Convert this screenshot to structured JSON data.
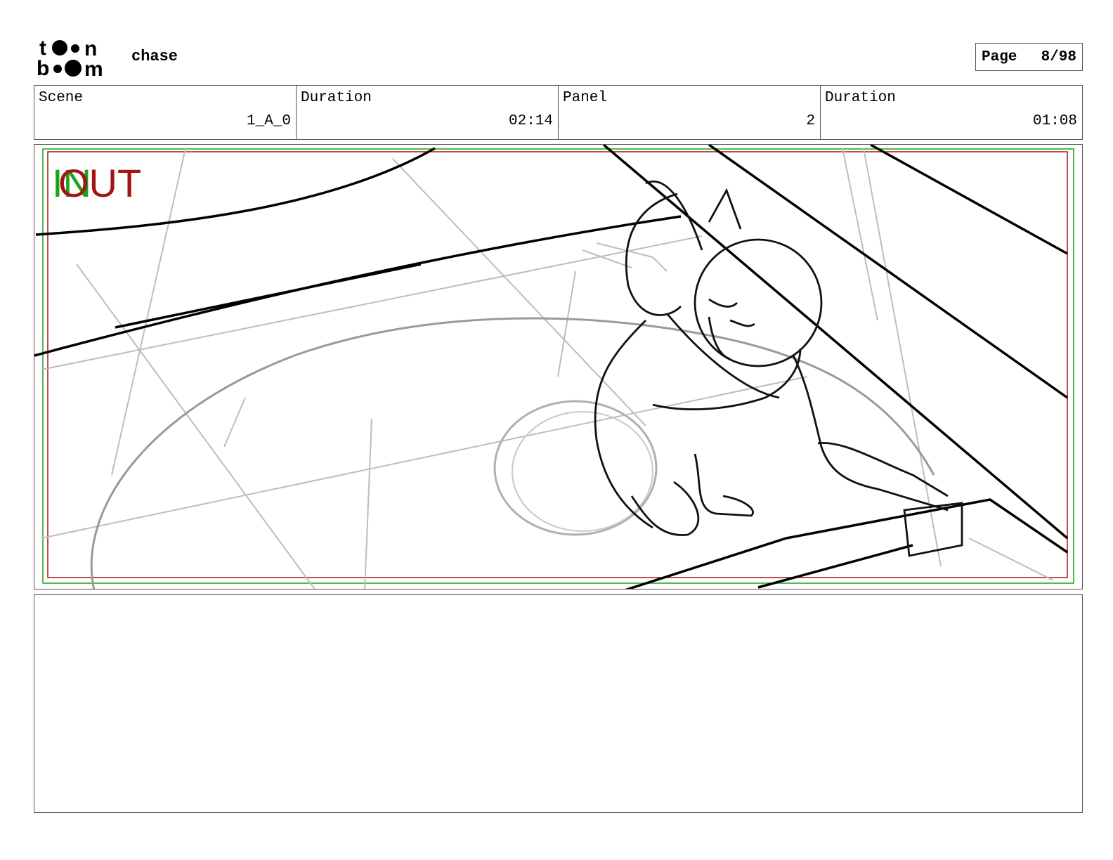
{
  "header": {
    "logo_text": "toon boom",
    "project_title": "chase",
    "page_label": "Page",
    "page_number": "8/98"
  },
  "info": [
    {
      "label": "Scene",
      "value": "1_A_0"
    },
    {
      "label": "Duration",
      "value": "02:14"
    },
    {
      "label": "Panel",
      "value": "2"
    },
    {
      "label": "Duration",
      "value": "01:08"
    }
  ],
  "panel": {
    "in_marker": "IN",
    "out_marker": "OUT",
    "safe_frame_colors": {
      "in": "#18a518",
      "out": "#a31515"
    }
  },
  "notes": {
    "text": ""
  }
}
